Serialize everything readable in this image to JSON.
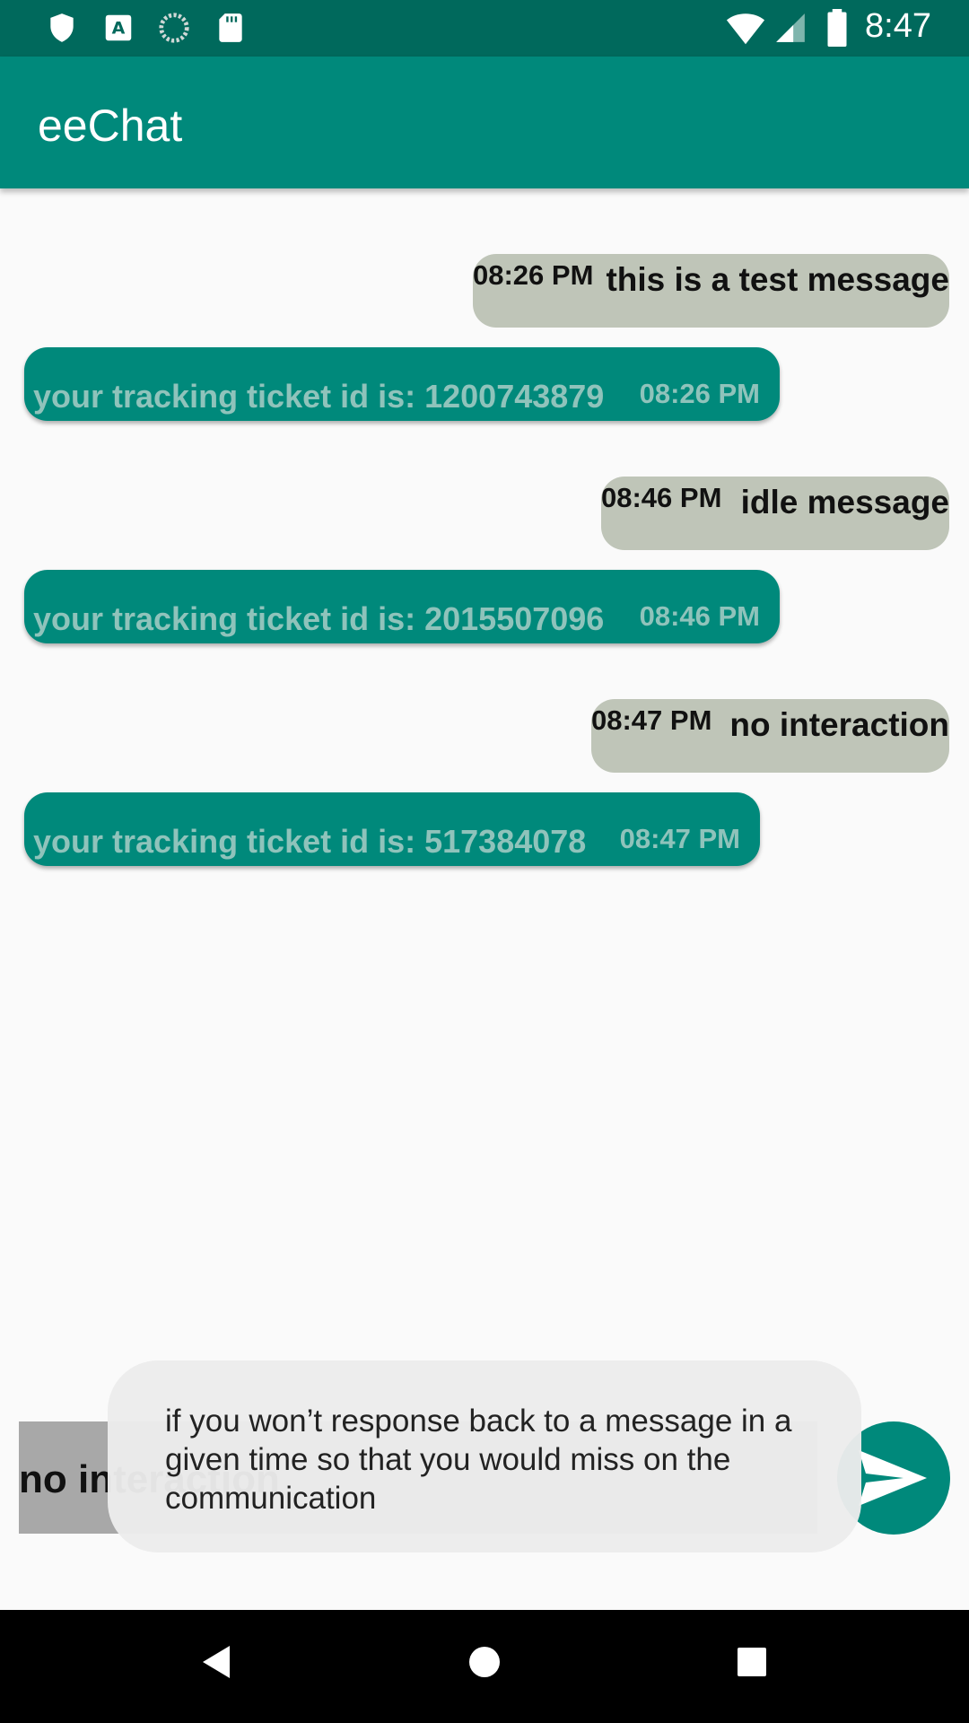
{
  "status_bar": {
    "time": "8:47",
    "left_icons": [
      "shield-icon",
      "a-badge-icon",
      "sync-icon",
      "sd-card-icon"
    ],
    "right_icons": [
      "wifi-icon",
      "cell-signal-icon",
      "battery-icon"
    ]
  },
  "app_bar": {
    "title": "eeChat"
  },
  "messages": [
    {
      "direction": "outgoing",
      "time": "08:26 PM",
      "text": "this is a test message"
    },
    {
      "direction": "incoming",
      "text": "your tracking ticket id is: 1200743879",
      "time": "08:26 PM"
    },
    {
      "direction": "outgoing",
      "time": "08:46 PM",
      "text": "idle message"
    },
    {
      "direction": "incoming",
      "text": "your tracking ticket id is: 2015507096",
      "time": "08:46 PM"
    },
    {
      "direction": "outgoing",
      "time": "08:47 PM",
      "text": "no interaction"
    },
    {
      "direction": "incoming",
      "text": "your tracking ticket id is: 517384078",
      "time": "08:47 PM"
    }
  ],
  "composer": {
    "value": "no interaction",
    "send_icon": "send-icon"
  },
  "tooltip": {
    "text": "if you won’t response back to a message in a given time so that you would  miss on the communication"
  },
  "nav_bar": {
    "icons": [
      "back-icon",
      "home-icon",
      "recents-icon"
    ]
  },
  "colors": {
    "status_bar": "#00695c",
    "app_bar": "#00897b",
    "outgoing_bubble": "#bfc5b8",
    "incoming_bubble": "#00897b"
  }
}
